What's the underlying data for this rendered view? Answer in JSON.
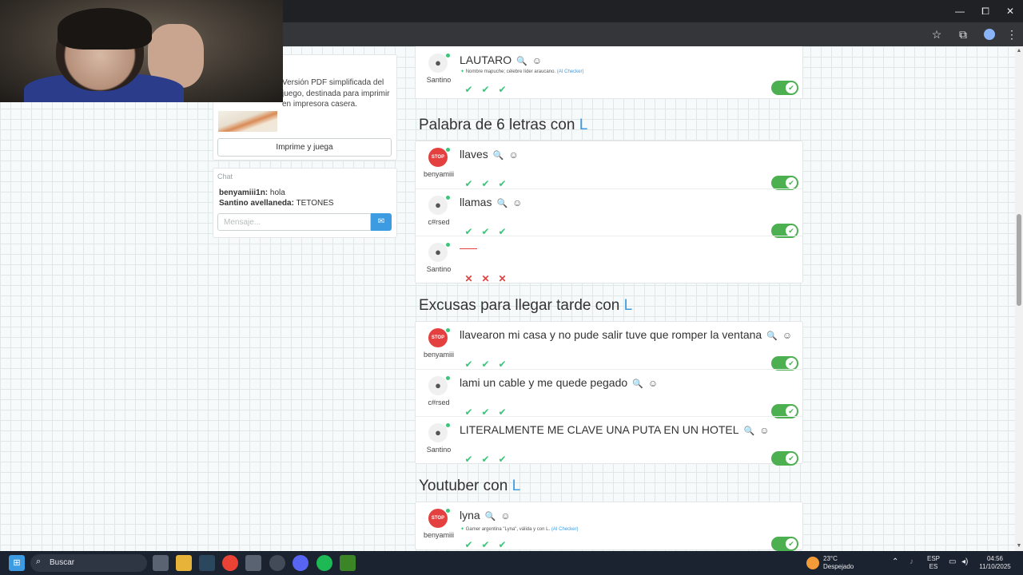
{
  "window_controls": {
    "minimize": "—",
    "maximize": "⧠",
    "close": "✕"
  },
  "toolbar_icons": {
    "bookmark": "☆",
    "extensions": "⧉",
    "menu": "⋮"
  },
  "print_widget": {
    "description": "Versión PDF simplificada del juego, destinada para imprimir en impresora casera.",
    "button_label": "Imprime y juega"
  },
  "chat": {
    "title": "Chat",
    "messages": [
      {
        "user": "benyamiii1n:",
        "text": " hola"
      },
      {
        "user": "Santino avellaneda:",
        "text": " TETONES"
      }
    ],
    "input_placeholder": "Mensaje..."
  },
  "top_entry": {
    "player": "Santino",
    "answer": "LAUTARO",
    "note": "Nombre mapuche; célebre líder araucano.",
    "note_source": "(AI Checker)",
    "votes": [
      "ok",
      "ok",
      "ok"
    ]
  },
  "sections": [
    {
      "title": "Palabra de 6 letras con ",
      "letter": "L",
      "entries": [
        {
          "player": "benyamiii",
          "avatar": "stop",
          "answer": "llaves",
          "votes": [
            "ok",
            "ok",
            "ok"
          ],
          "toggle": true
        },
        {
          "player": "c#rsed",
          "avatar": "user",
          "answer": "llamas",
          "votes": [
            "ok",
            "ok",
            "ok"
          ],
          "toggle": true
        },
        {
          "player": "Santino",
          "avatar": "user",
          "answer": "",
          "votes": [
            "bad",
            "bad",
            "bad"
          ],
          "toggle": false
        }
      ]
    },
    {
      "title": "Excusas para llegar tarde con ",
      "letter": "L",
      "entries": [
        {
          "player": "benyamiii",
          "avatar": "stop",
          "answer": "llavearon mi casa y no pude salir tuve que romper la ventana",
          "votes": [
            "ok",
            "ok",
            "ok"
          ],
          "toggle": true
        },
        {
          "player": "c#rsed",
          "avatar": "user",
          "answer": "lami un cable y me quede pegado",
          "votes": [
            "ok",
            "ok",
            "ok"
          ],
          "toggle": true
        },
        {
          "player": "Santino",
          "avatar": "user",
          "answer": "LITERALMENTE ME CLAVE UNA PUTA EN UN HOTEL",
          "votes": [
            "ok",
            "ok",
            "ok"
          ],
          "toggle": true
        }
      ]
    },
    {
      "title": "Youtuber con ",
      "letter": "L",
      "entries": [
        {
          "player": "benyamiii",
          "avatar": "stop",
          "answer": "lyna",
          "note": "Gamer argentina \"Lyna\", válida y con L.",
          "note_source": "(AI Checker)",
          "votes": [
            "ok",
            "ok",
            "ok"
          ],
          "toggle": true
        }
      ]
    }
  ],
  "taskbar": {
    "search_label": "Buscar",
    "weather_temp": "23°C",
    "weather_desc": "Despejado",
    "lang_top": "ESP",
    "lang_bottom": "ES",
    "time": "04:56",
    "date": "11/10/2025"
  },
  "colors": {
    "accent": "#3c9be1",
    "ok": "#3cc57a",
    "bad": "#e3403f",
    "toggle": "#4caf50"
  }
}
